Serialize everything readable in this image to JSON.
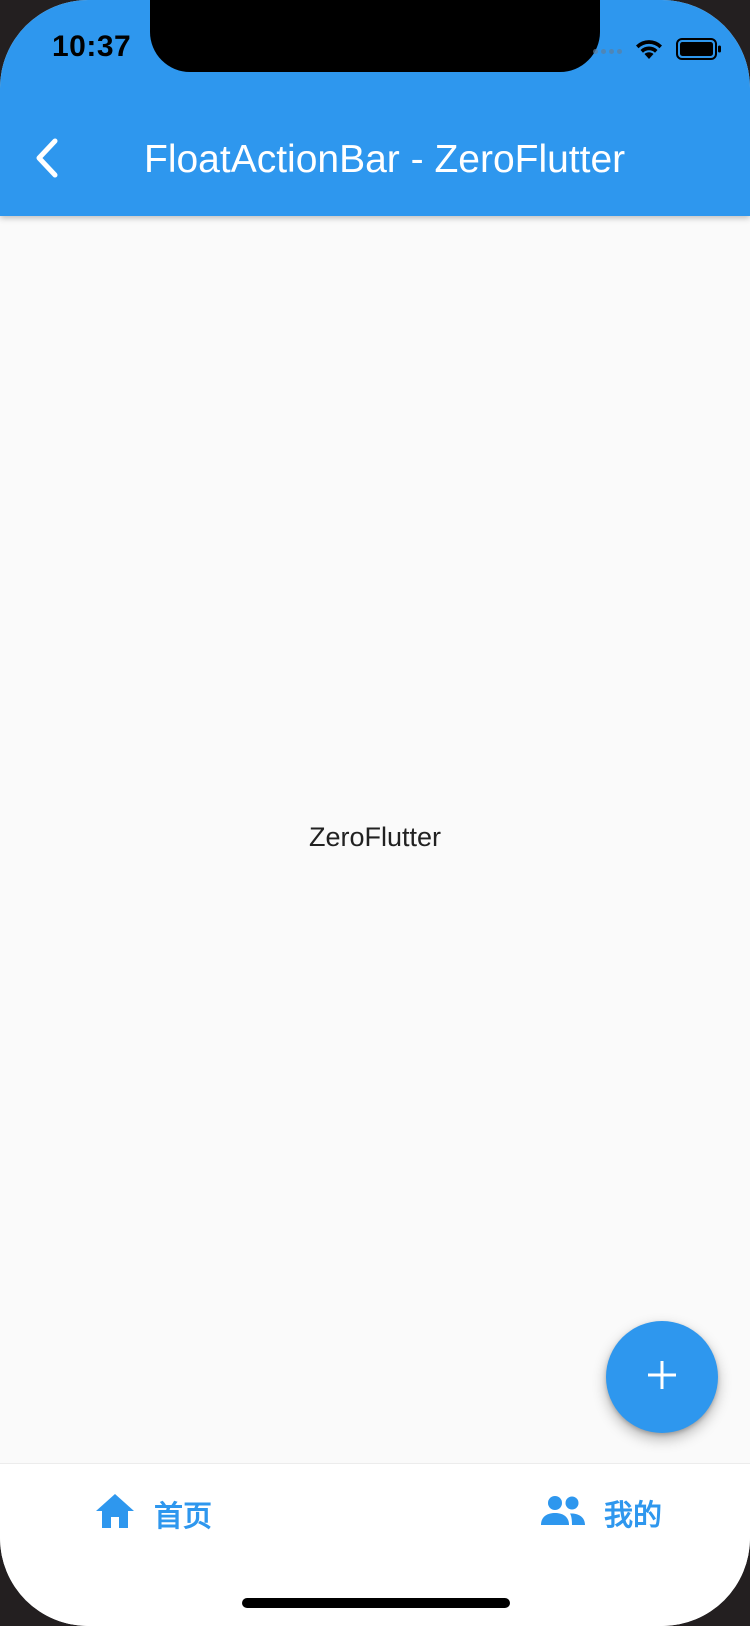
{
  "status_bar": {
    "time": "10:37"
  },
  "app_bar": {
    "title": "FloatActionBar - ZeroFlutter",
    "back_icon": "chevron-left-icon"
  },
  "body": {
    "center_text": "ZeroFlutter"
  },
  "fab": {
    "icon": "plus-icon"
  },
  "bottom_nav": {
    "items": [
      {
        "label": "首页",
        "icon": "home-icon"
      },
      {
        "label": "我的",
        "icon": "people-icon"
      }
    ]
  },
  "colors": {
    "primary": "#2e97ee",
    "background": "#fafafa",
    "bottom_bar": "#ffffff"
  }
}
